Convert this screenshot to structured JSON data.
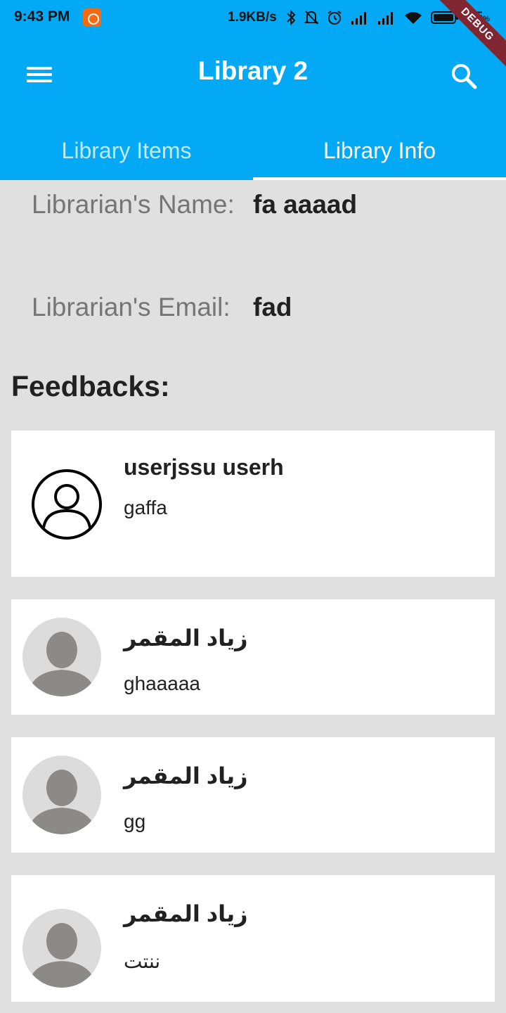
{
  "status_bar": {
    "time": "9:43 PM",
    "speed": "1.9KB/s",
    "battery": "95",
    "battery_unit": "%"
  },
  "debug_banner": "DEBUG",
  "app_bar": {
    "title": "Library 2",
    "tabs": [
      {
        "label": "Library Items",
        "selected": false
      },
      {
        "label": "Library Info",
        "selected": true
      }
    ]
  },
  "info": {
    "name_label": "Librarian's Name:",
    "name_value": "fa aaaad",
    "email_label": "Librarian's Email:",
    "email_value": "fad"
  },
  "feedbacks": {
    "title": "Feedbacks:",
    "items": [
      {
        "name": "userjssu userh",
        "text": "gaffa",
        "avatar": "outline"
      },
      {
        "name": "زياد المقمر",
        "text": "ghaaaaa",
        "avatar": "photo-placeholder"
      },
      {
        "name": "زياد المقمر",
        "text": "gg",
        "avatar": "photo-placeholder"
      },
      {
        "name": "زياد المقمر",
        "text": "ننتت",
        "avatar": "photo-placeholder"
      }
    ]
  },
  "colors": {
    "primary": "#03a9f4",
    "background": "#e0e0e0",
    "card": "#ffffff",
    "debug": "#7f2630"
  }
}
